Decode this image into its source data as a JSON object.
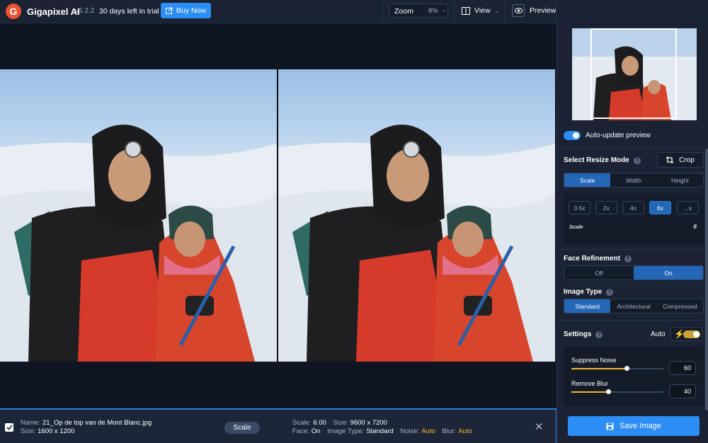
{
  "app": {
    "name": "Gigapixel AI",
    "version": "v5.2.2",
    "trial": "30 days left in trial",
    "buy_label": "Buy Now"
  },
  "toolbar": {
    "zoom_label": "Zoom",
    "zoom_value": "8%",
    "view_label": "View",
    "preview_label": "Preview"
  },
  "infobar": {
    "name_label": "Name:",
    "name_value": "21_Op de top van de Mont Blanc.jpg",
    "size_label": "Size:",
    "size_value": "1600 x 1200",
    "mode_pill": "Scale",
    "scale_label": "Scale:",
    "scale_value": "6.00",
    "out_size_label": "Size:",
    "out_size_value": "9600 x 7200",
    "face_label": "Face:",
    "face_value": "On",
    "type_label": "Image Type:",
    "type_value": "Standard",
    "noise_label": "Noise:",
    "noise_value": "Auto",
    "blur_label": "Blur:",
    "blur_value": "Auto"
  },
  "sidebar": {
    "auto_update_label": "Auto-update preview",
    "resize_mode_title": "Select Resize Mode",
    "crop_label": "Crop",
    "resize_modes": [
      "Scale",
      "Width",
      "Height"
    ],
    "scale_options": [
      "0.5x",
      "2x",
      "4x",
      "6x",
      "...x"
    ],
    "scale_field_label": "Scale",
    "scale_field_value": "6",
    "face_title": "Face Refinement",
    "face_options": [
      "Off",
      "On"
    ],
    "image_type_title": "Image Type",
    "image_types": [
      "Standard",
      "Architectural",
      "Compressed"
    ],
    "settings_title": "Settings",
    "auto_label": "Auto",
    "suppress_noise_label": "Suppress Noise",
    "suppress_noise_value": "60",
    "remove_blur_label": "Remove Blur",
    "remove_blur_value": "40",
    "save_label": "Save Image"
  },
  "state": {
    "resize_mode_selected": "Scale",
    "scale_selected": "6x",
    "face_selected": "On",
    "image_type_selected": "Standard",
    "auto_update_on": true,
    "settings_auto_on": true,
    "suppress_noise_level": 0.6,
    "remove_blur_level": 0.4
  },
  "colors": {
    "accent": "#2c8df4",
    "brand": "#e8542e",
    "highlight": "#f3b52b"
  },
  "icons": [
    "gigapixel-logo-icon",
    "external-link-icon",
    "chevron-down-icon",
    "split-view-icon",
    "eye-icon",
    "crop-icon",
    "help-icon",
    "lightning-icon",
    "close-icon",
    "checkbox-icon",
    "save-icon"
  ]
}
